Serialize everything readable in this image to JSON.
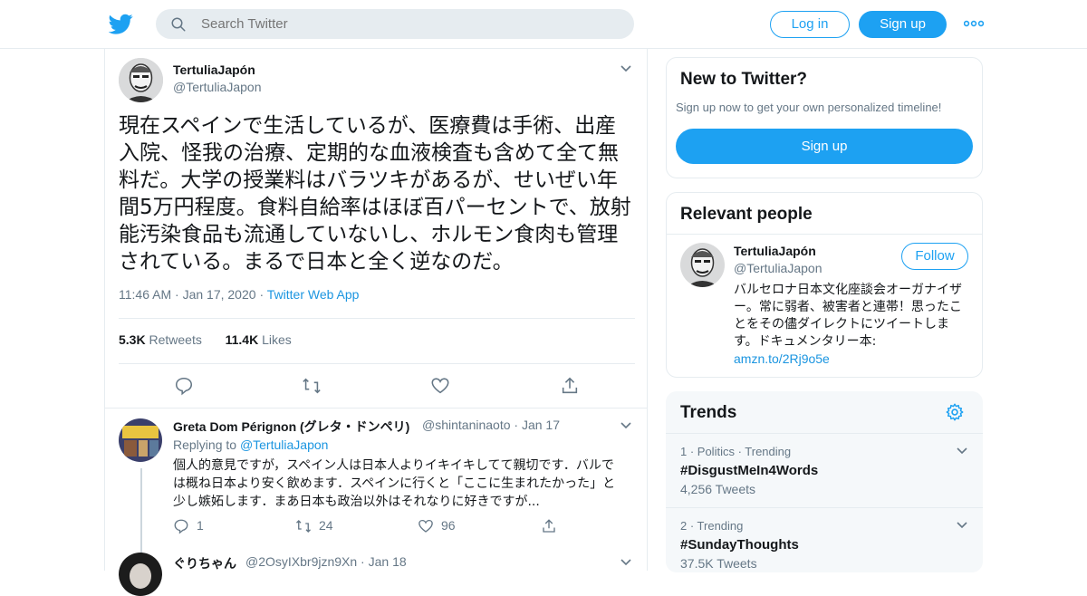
{
  "header": {
    "search_placeholder": "Search Twitter",
    "login_label": "Log in",
    "signup_label": "Sign up",
    "brand_color": "#1da1f2"
  },
  "tweet": {
    "display_name": "TertuliaJapón",
    "handle": "@TertuliaJapon",
    "text": "現在スペインで生活しているが、医療費は手術、出産入院、怪我の治療、定期的な血液検査も含めて全て無料だ。大学の授業料はバラツキがあるが、せいぜい年間5万円程度。食料自給率はほぼ百パーセントで、放射能汚染食品も流通していないし、ホルモン食肉も管理されている。まるで日本と全く逆なのだ。",
    "time": "11:46 AM",
    "date": "Jan 17, 2020",
    "source": "Twitter Web App",
    "retweets_count": "5.3K",
    "retweets_label": "Retweets",
    "likes_count": "11.4K",
    "likes_label": "Likes"
  },
  "replies": [
    {
      "display_name": "Greta Dom Pérignon (グレタ・ドンペリ)",
      "handle": "@shintaninaoto",
      "date": "Jan 17",
      "replying_prefix": "Replying to",
      "replying_to": "@TertuliaJapon",
      "text": "個人的意見ですが，スペイン人は日本人よりイキイキしてて親切です．バルでは概ね日本より安く飲めます．スペインに行くと「ここに生まれたかった」と少し嫉妬します．まあ日本も政治以外はそれなりに好きですが...",
      "reply_count": "1",
      "retweet_count": "24",
      "like_count": "96"
    },
    {
      "display_name": "ぐりちゃん",
      "handle": "@2OsyIXbr9jzn9Xn",
      "date": "Jan 18"
    }
  ],
  "sidebar": {
    "new_title": "New to Twitter?",
    "new_sub": "Sign up now to get your own personalized timeline!",
    "new_signup": "Sign up",
    "relevant_title": "Relevant people",
    "person_name": "TertuliaJapón",
    "person_handle": "@TertuliaJapon",
    "follow_label": "Follow",
    "person_bio": "バルセロナ日本文化座談会オーガナイザー。常に弱者、被害者と連帯！思ったことをその儘ダイレクトにツイートします。ドキュメンタリー本: ",
    "person_link": "amzn.to/2Rj9o5e",
    "trends_title": "Trends",
    "trends": [
      {
        "meta": "1 · Politics · Trending",
        "name": "#DisgustMeIn4Words",
        "count": "4,256 Tweets"
      },
      {
        "meta": "2 · Trending",
        "name": "#SundayThoughts",
        "count": "37.5K Tweets"
      }
    ]
  }
}
